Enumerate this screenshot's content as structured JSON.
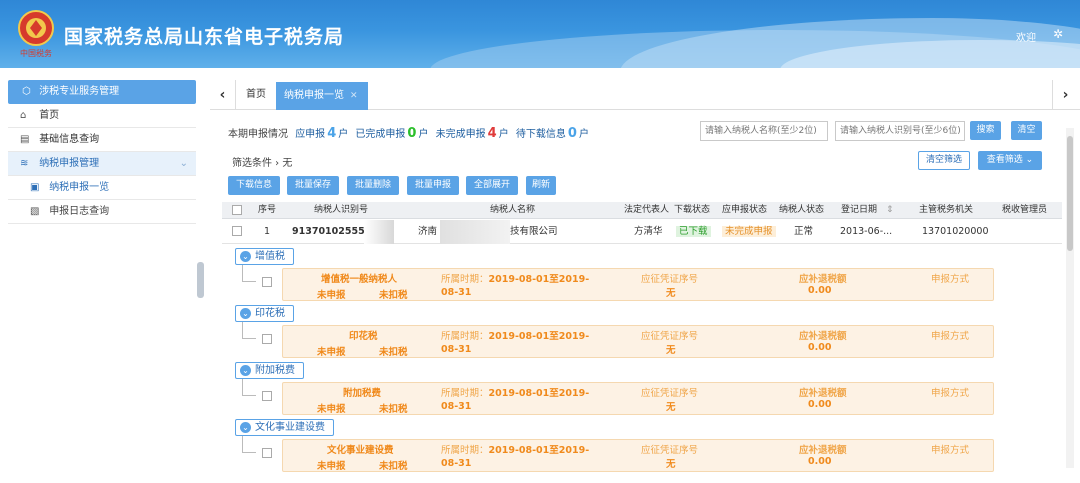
{
  "header": {
    "title": "国家税务总局山东省电子税务局",
    "emblem_text": "中国税务",
    "welcome": "欢迎",
    "colors": {
      "header_blue": "#2f87d6",
      "accent": "#5aa3e6"
    }
  },
  "sidebar": {
    "section": "涉税专业服务管理",
    "items": [
      {
        "label": "首页",
        "icon": "home-icon"
      },
      {
        "label": "基础信息查询",
        "icon": "document-icon"
      },
      {
        "label": "纳税申报管理",
        "icon": "layers-icon"
      }
    ],
    "subitems": [
      {
        "label": "纳税申报一览",
        "icon": "file-icon"
      },
      {
        "label": "申报日志查询",
        "icon": "log-icon"
      }
    ]
  },
  "tabs": {
    "home": "首页",
    "active": "纳税申报一览"
  },
  "summary": {
    "label": "本期申报情况",
    "to_declare_label": "应申报",
    "to_declare_count": "4",
    "unit1": "户",
    "done_label": "已完成申报",
    "done_count": "0",
    "unit2": "户",
    "undone_label": "未完成申报",
    "undone_count": "4",
    "unit3": "户",
    "pending_label": "待下载信息",
    "pending_count": "0",
    "unit4": "户"
  },
  "search": {
    "name_placeholder": "请输入纳税人名称(至少2位)",
    "id_placeholder": "请输入纳税人识别号(至少6位)",
    "search_button": "搜索",
    "clear_button": "清空",
    "clear_filter_button": "清空筛选",
    "view_filter_button": "查看筛选"
  },
  "filter": {
    "label": "筛选条件 › 无"
  },
  "toolbar": [
    "下载信息",
    "批量保存",
    "批量删除",
    "批量申报",
    "全部展开",
    "刷新"
  ],
  "table": {
    "columns": [
      "序号",
      "纳税人识别号",
      "纳税人名称",
      "法定代表人",
      "下载状态",
      "应申报状态",
      "纳税人状态",
      "登记日期",
      "主管税务机关",
      "税收管理员"
    ],
    "sort_icon": "⇕",
    "rows": [
      {
        "index": "1",
        "tax_id": "913701025553",
        "name_prefix": "济南",
        "name_suffix": "技有限公司",
        "legal_rep": "方清华",
        "download_status": "已下载",
        "declare_status": "未完成申报",
        "taxpayer_status": "正常",
        "reg_date": "2013-06-...",
        "authority": "13701020000",
        "officer": ""
      }
    ]
  },
  "tax_groups": [
    {
      "label": "增值税",
      "name": "增值税一般纳税人",
      "status1": "未申报",
      "status2": "未扣税",
      "period_label": "所属时期：",
      "period_value": "2019-08-01至2019-",
      "period_end": "08-31",
      "cert_label": "应征凭证序号",
      "cert_value": "无",
      "amount_label": "应补退税额",
      "amount": "0.00",
      "method_label": "申报方式"
    },
    {
      "label": "印花税",
      "name": "印花税",
      "status1": "未申报",
      "status2": "未扣税",
      "period_label": "所属时期：",
      "period_value": "2019-08-01至2019-",
      "period_end": "08-31",
      "cert_label": "应征凭证序号",
      "cert_value": "无",
      "amount_label": "应补退税额",
      "amount": "0.00",
      "method_label": "申报方式"
    },
    {
      "label": "附加税费",
      "name": "附加税费",
      "status1": "未申报",
      "status2": "未扣税",
      "period_label": "所属时期：",
      "period_value": "2019-08-01至2019-",
      "period_end": "08-31",
      "cert_label": "应征凭证序号",
      "cert_value": "无",
      "amount_label": "应补退税额",
      "amount": "0.00",
      "method_label": "申报方式"
    },
    {
      "label": "文化事业建设费",
      "name": "文化事业建设费",
      "status1": "未申报",
      "status2": "未扣税",
      "period_label": "所属时期：",
      "period_value": "2019-08-01至2019-",
      "period_end": "08-31",
      "cert_label": "应征凭证序号",
      "cert_value": "无",
      "amount_label": "应补退税额",
      "amount": "0.00",
      "method_label": "申报方式"
    }
  ]
}
